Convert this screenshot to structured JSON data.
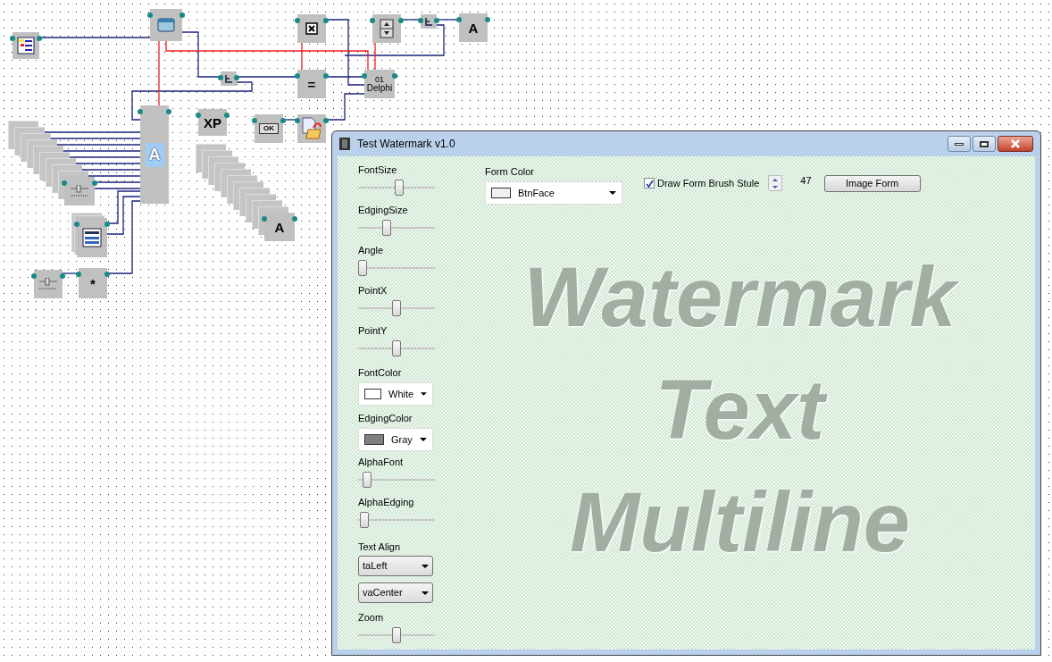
{
  "canvas": {
    "nodes": [
      {
        "kind": "panel"
      },
      {
        "kind": "window"
      },
      {
        "kind": "checkbox"
      },
      {
        "kind": "updown"
      },
      {
        "kind": "hub"
      },
      {
        "kind": "text",
        "label": "A"
      },
      {
        "kind": "hub"
      },
      {
        "kind": "text",
        "label": "="
      },
      {
        "kind": "code",
        "label": "Delphi",
        "sub": "01"
      },
      {
        "kind": "bigtext",
        "label": "A"
      },
      {
        "kind": "text",
        "label": "XP"
      },
      {
        "kind": "okbutton",
        "label": "OK"
      },
      {
        "kind": "open"
      },
      {
        "kind": "slider_stack"
      },
      {
        "kind": "list_stack"
      },
      {
        "kind": "slider"
      },
      {
        "kind": "text",
        "label": "*"
      },
      {
        "kind": "text_stack",
        "label": "A"
      }
    ]
  },
  "window": {
    "title": "Test Watermark v1.0",
    "controls": [
      {
        "kind": "slider",
        "label": "FontSize",
        "level": 0.54
      },
      {
        "kind": "slider",
        "label": "EdgingSize",
        "level": 0.36
      },
      {
        "kind": "slider",
        "label": "Angle",
        "level": 0.0
      },
      {
        "kind": "slider",
        "label": "PointX",
        "level": 0.5
      },
      {
        "kind": "slider",
        "label": "PointY",
        "level": 0.5
      },
      {
        "kind": "color",
        "label": "FontColor",
        "value": "White",
        "color": "#ffffff"
      },
      {
        "kind": "color",
        "label": "EdgingColor",
        "value": "Gray",
        "color": "#808080"
      },
      {
        "kind": "slider",
        "label": "AlphaFont",
        "level": 0.06
      },
      {
        "kind": "slider",
        "label": "AlphaEdging",
        "level": 0.02
      },
      {
        "kind": "heading",
        "label": "Text Align"
      },
      {
        "kind": "select",
        "value": "taLeft"
      },
      {
        "kind": "select",
        "value": "vaCenter"
      },
      {
        "kind": "slider",
        "label": "Zoom",
        "level": 0.5
      }
    ],
    "form_color": {
      "label": "Form Color",
      "value": "BtnFace",
      "color": "#f0f0f0"
    },
    "brush_style": {
      "label": "Draw Form Brush Stule",
      "checked": true
    },
    "spin_value": "47",
    "image_button": "Image Form",
    "watermark_lines": [
      "Watermark",
      "Text",
      "Multiline"
    ]
  }
}
